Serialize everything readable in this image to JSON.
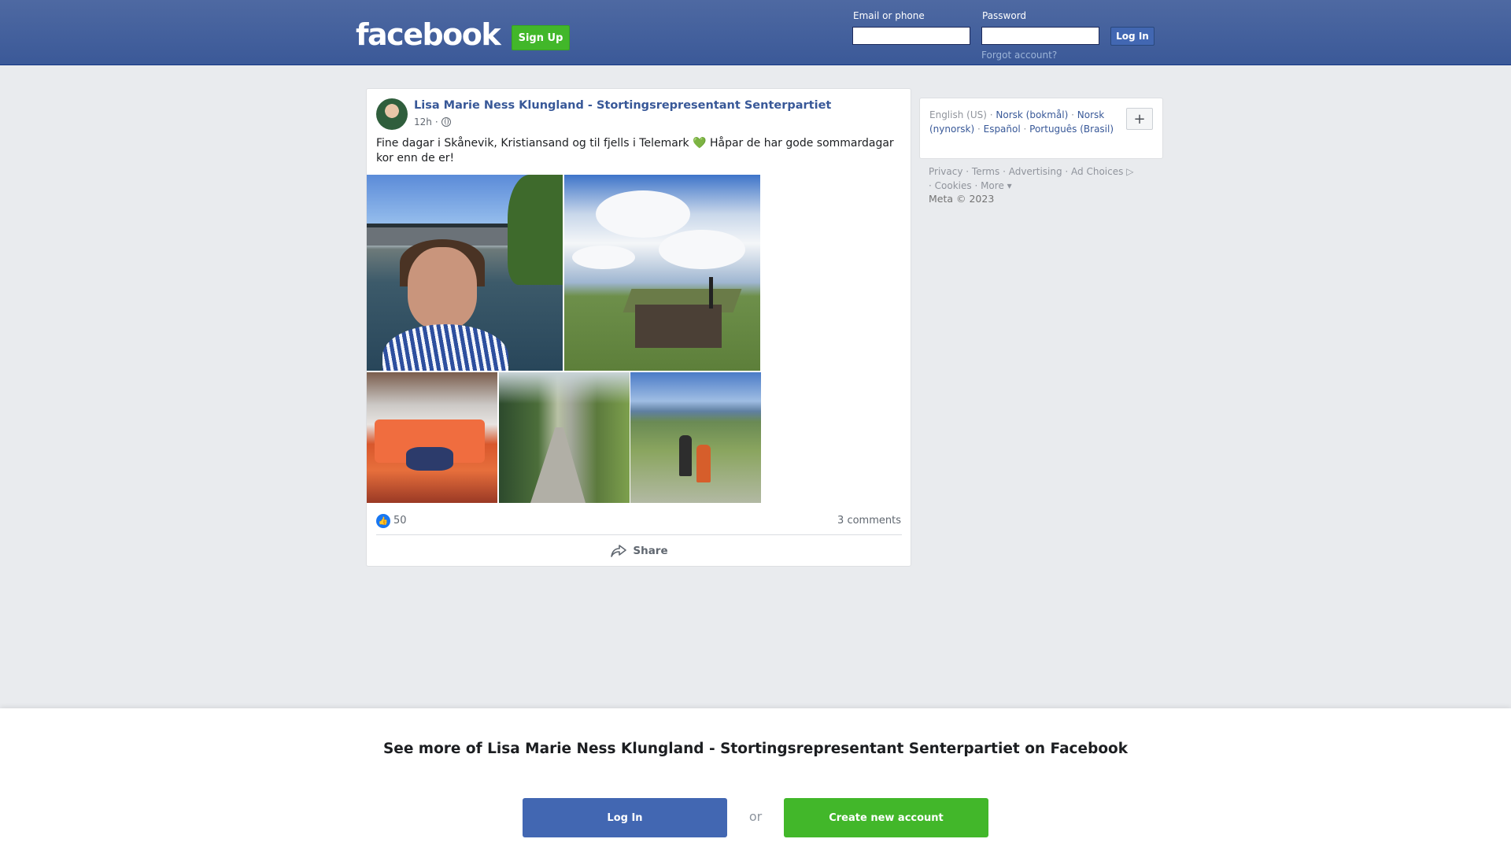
{
  "header": {
    "logo": "facebook",
    "signup_label": "Sign Up",
    "email_label": "Email or phone",
    "password_label": "Password",
    "login_label": "Log In",
    "forgot_label": "Forgot account?"
  },
  "post": {
    "author": "Lisa Marie Ness Klungland - Stortingsrepresentant Senterpartiet",
    "time": "12h",
    "time_separator": "·",
    "privacy_icon": "globe-icon",
    "text": "Fine dagar i Skånevik, Kristiansand og til fjells i Telemark 💚 Håpar de har gode sommardagar kor enn de er!",
    "photos": [
      "selfie-bridge",
      "mountain-hut",
      "seafood-tray",
      "forest-path",
      "hikers-mountain"
    ],
    "likes": "50",
    "comments": "3 comments",
    "share_label": "Share"
  },
  "sidebar": {
    "languages": [
      {
        "label": "English (US)",
        "link": false
      },
      {
        "label": "Norsk (bokmål)",
        "link": true
      },
      {
        "label": "Norsk (nynorsk)",
        "link": true
      },
      {
        "label": "Español",
        "link": true
      },
      {
        "label": "Português (Brasil)",
        "link": true
      }
    ],
    "plus_label": "+",
    "footer_links": [
      "Privacy",
      "Terms",
      "Advertising",
      "Ad Choices",
      "Cookies",
      "More"
    ],
    "copyright": "Meta © 2023"
  },
  "banner": {
    "title": "See more of Lisa Marie Ness Klungland - Stortingsrepresentant Senterpartiet on Facebook",
    "login_label": "Log In",
    "or_label": "or",
    "create_label": "Create new account"
  },
  "colors": {
    "brand_blue": "#3b5998",
    "link": "#385898",
    "green": "#42b72a",
    "background": "#e9ebee"
  }
}
